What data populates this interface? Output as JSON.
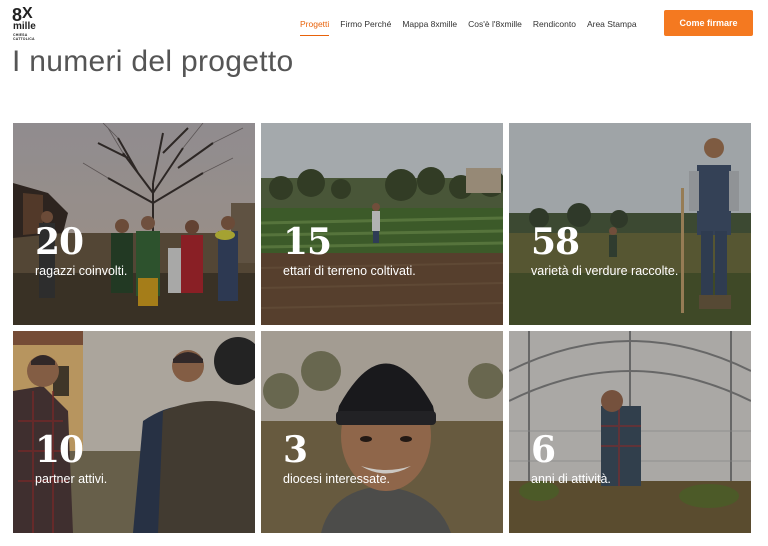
{
  "logo": {
    "big": "8",
    "x": "X",
    "mille": "mille",
    "sub_line1": "CHIESA",
    "sub_line2": "CATTOLICA"
  },
  "nav": {
    "items": [
      {
        "label": "Progetti",
        "active": true
      },
      {
        "label": "Firmo Perché"
      },
      {
        "label": "Mappa 8xmille"
      },
      {
        "label": "Cos'è l'8xmille"
      },
      {
        "label": "Rendiconto"
      },
      {
        "label": "Area Stampa"
      }
    ],
    "cta": "Come firmare"
  },
  "page": {
    "title": "I numeri del progetto"
  },
  "tiles": [
    {
      "number": "20",
      "label": "ragazzi coinvolti."
    },
    {
      "number": "15",
      "label": "ettari di terreno coltivati."
    },
    {
      "number": "58",
      "label": "varietà di verdure raccolte."
    },
    {
      "number": "10",
      "label": "partner attivi."
    },
    {
      "number": "3",
      "label": "diocesi interessate."
    },
    {
      "number": "6",
      "label": "anni di attività."
    }
  ],
  "colors": {
    "accent": "#f47920",
    "active_nav": "#e8620a"
  }
}
